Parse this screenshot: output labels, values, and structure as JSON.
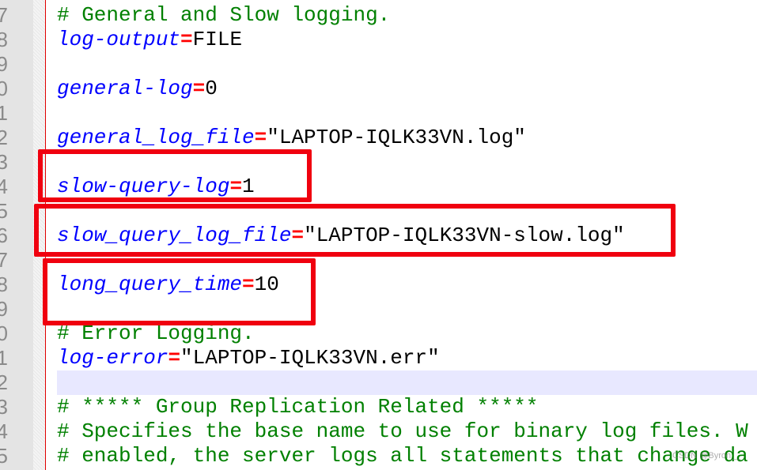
{
  "editor": {
    "lines": [
      {
        "num": "7",
        "type": "comment",
        "text": "# General and Slow logging."
      },
      {
        "num": "8",
        "type": "kv",
        "key": "log-output",
        "value": "FILE"
      },
      {
        "num": "9",
        "type": "blank"
      },
      {
        "num": "0",
        "type": "kv",
        "key": "general-log",
        "value": "0"
      },
      {
        "num": "1",
        "type": "blank"
      },
      {
        "num": "2",
        "type": "kv",
        "key": "general_log_file",
        "value": "\"LAPTOP-IQLK33VN.log\""
      },
      {
        "num": "3",
        "type": "blank"
      },
      {
        "num": "4",
        "type": "kv",
        "key": "slow-query-log",
        "value": "1"
      },
      {
        "num": "5",
        "type": "blank"
      },
      {
        "num": "6",
        "type": "kv",
        "key": "slow_query_log_file",
        "value": "\"LAPTOP-IQLK33VN-slow.log\""
      },
      {
        "num": "7",
        "type": "blank"
      },
      {
        "num": "8",
        "type": "kv",
        "key": "long_query_time",
        "value": "10"
      },
      {
        "num": "9",
        "type": "blank"
      },
      {
        "num": "0",
        "type": "comment",
        "text": "# Error Logging."
      },
      {
        "num": "1",
        "type": "kv",
        "key": "log-error",
        "value": "\"LAPTOP-IQLK33VN.err\""
      },
      {
        "num": "2",
        "type": "blank",
        "highlight": true
      },
      {
        "num": "3",
        "type": "comment",
        "text": "# ***** Group Replication Related *****"
      },
      {
        "num": "4",
        "type": "comment",
        "text": "# Specifies the base name to use for binary log files. W"
      },
      {
        "num": "5",
        "type": "comment",
        "text": "# enabled, the server logs all statements that change da"
      }
    ],
    "equals": "="
  },
  "watermark": "CSDN @Byron__",
  "colors": {
    "keyword": "#0000ff",
    "operator": "#ff0000",
    "comment": "#008000",
    "highlight": "#e8e8ff",
    "annotation_box": "#f0000f"
  }
}
